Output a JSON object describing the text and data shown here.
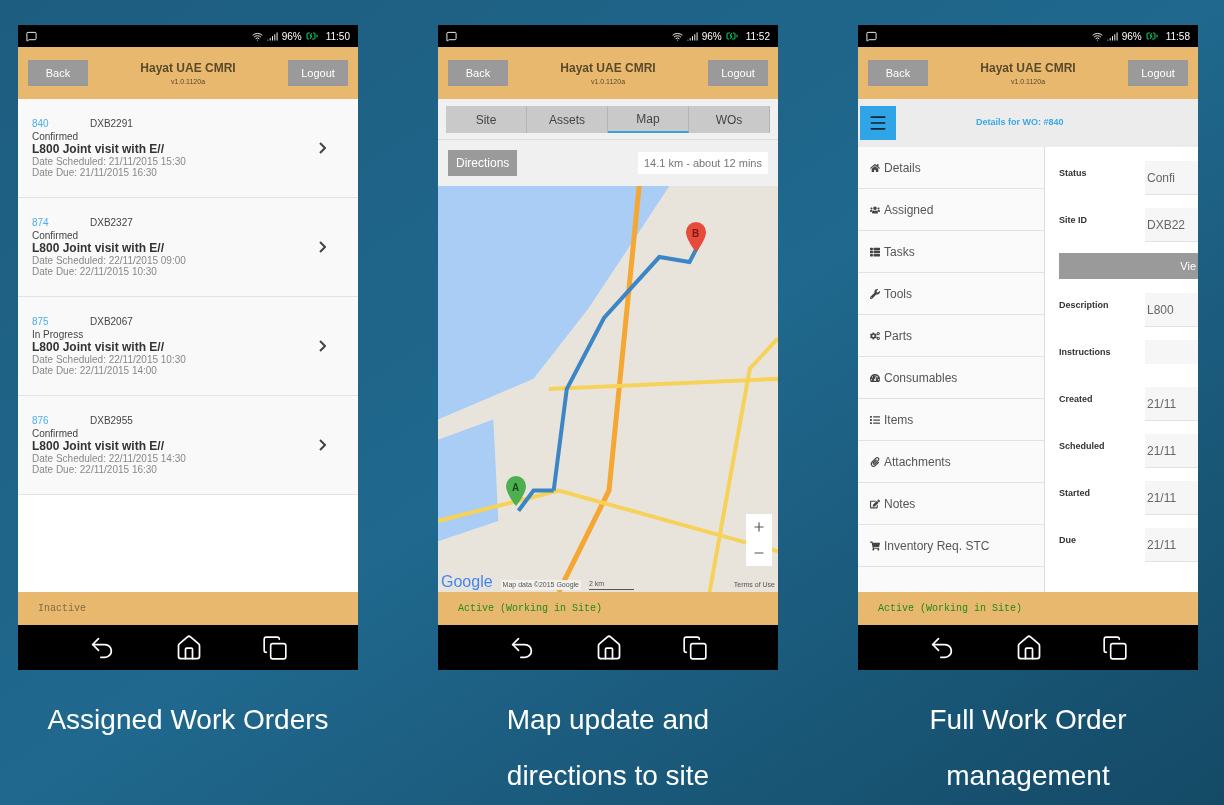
{
  "phones": [
    {
      "kind": "work_orders",
      "time": "11:50",
      "battery": "96%",
      "header": {
        "back": "Back",
        "title": "Hayat UAE CMRI",
        "version": "v1.0.1120a",
        "logout": "Logout"
      },
      "orders": [
        {
          "id": "840",
          "site": "DXB2291",
          "status": "Confirmed",
          "title": "L800 Joint visit with E//",
          "scheduled": "Date Scheduled: 21/11/2015 15:30",
          "due": "Date Due: 21/11/2015 16:30"
        },
        {
          "id": "874",
          "site": "DXB2327",
          "status": "Confirmed",
          "title": "L800 Joint visit with E//",
          "scheduled": "Date Scheduled: 22/11/2015 09:00",
          "due": "Date Due: 22/11/2015 10:30"
        },
        {
          "id": "875",
          "site": "DXB2067",
          "status": "In Progress",
          "title": "L800 Joint visit with E//",
          "scheduled": "Date Scheduled: 22/11/2015 10:30",
          "due": "Date Due: 22/11/2015 14:00"
        },
        {
          "id": "876",
          "site": "DXB2955",
          "status": "Confirmed",
          "title": "L800 Joint visit with E//",
          "scheduled": "Date Scheduled: 22/11/2015 14:30",
          "due": "Date Due: 22/11/2015 16:30"
        }
      ],
      "footer": {
        "text": "Inactive",
        "active": false
      },
      "caption": "Assigned Work Orders"
    },
    {
      "kind": "map",
      "time": "11:52",
      "battery": "96%",
      "header": {
        "back": "Back",
        "title": "Hayat UAE CMRI",
        "version": "v1.0.1120a",
        "logout": "Logout"
      },
      "tabs": [
        {
          "label": "Site",
          "selected": false
        },
        {
          "label": "Assets",
          "selected": false
        },
        {
          "label": "Map",
          "selected": true
        },
        {
          "label": "WOs",
          "selected": false
        }
      ],
      "directions": "Directions",
      "route_info": "14.1 km - about 12 mins",
      "map": {
        "logo": "Google",
        "attribution": "Map data ©2015 Google",
        "scale": "2 km",
        "terms": "Terms of Use",
        "marker_start": "A",
        "marker_end": "B"
      },
      "footer": {
        "text": "Active (Working in Site)",
        "active": true
      },
      "caption": "Map update and directions to site"
    },
    {
      "kind": "details",
      "time": "11:58",
      "battery": "96%",
      "header": {
        "back": "Back",
        "title": "Hayat UAE CMRI",
        "version": "v1.0.1120a",
        "logout": "Logout"
      },
      "heading": "Details for WO: #840",
      "menu": [
        {
          "label": "Details"
        },
        {
          "label": "Assigned"
        },
        {
          "label": "Tasks"
        },
        {
          "label": "Tools"
        },
        {
          "label": "Parts"
        },
        {
          "label": "Consumables"
        },
        {
          "label": "Items"
        },
        {
          "label": "Attachments"
        },
        {
          "label": "Notes"
        },
        {
          "label": "Inventory Req. STC"
        }
      ],
      "fields": [
        {
          "kind": "field",
          "label": "Status",
          "value": "Confi"
        },
        {
          "kind": "field",
          "label": "Site ID",
          "value": "DXB22"
        },
        {
          "kind": "button",
          "label": "Vie"
        },
        {
          "kind": "field",
          "label": "Description",
          "value": "L800"
        },
        {
          "kind": "field",
          "label": "Instructions"
        },
        {
          "kind": "field",
          "label": "Created",
          "value": "21/11"
        },
        {
          "kind": "field",
          "label": "Scheduled",
          "value": "21/11"
        },
        {
          "kind": "field",
          "label": "Started",
          "value": "21/11"
        },
        {
          "kind": "field",
          "label": "Due",
          "value": "21/11"
        }
      ],
      "footer": {
        "text": "Active (Working in Site)",
        "active": true
      },
      "caption": "Full Work Order management"
    }
  ]
}
